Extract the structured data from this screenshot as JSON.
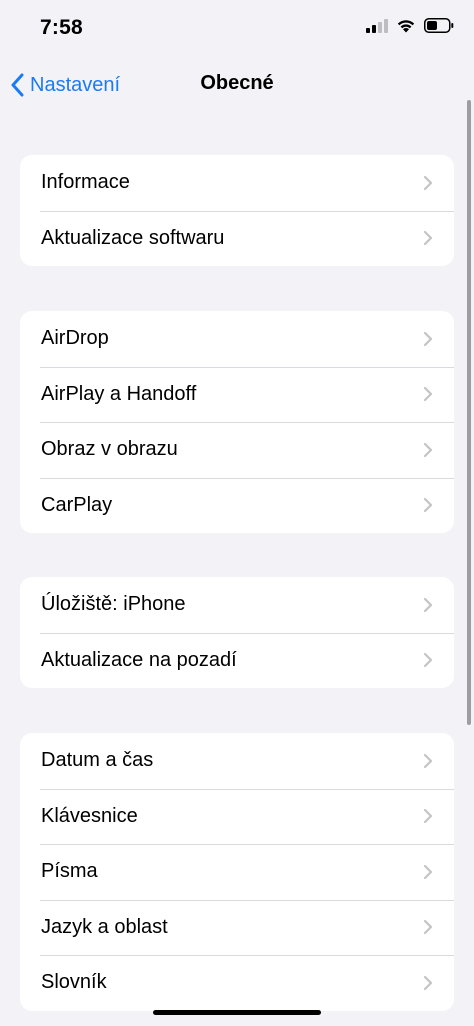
{
  "status_bar": {
    "time": "7:58"
  },
  "nav": {
    "back_label": "Nastavení",
    "title": "Obecné"
  },
  "groups": [
    {
      "items": [
        {
          "label": "Informace"
        },
        {
          "label": "Aktualizace softwaru"
        }
      ]
    },
    {
      "items": [
        {
          "label": "AirDrop"
        },
        {
          "label": "AirPlay a Handoff"
        },
        {
          "label": "Obraz v obrazu"
        },
        {
          "label": "CarPlay"
        }
      ]
    },
    {
      "items": [
        {
          "label": "Úložiště: iPhone"
        },
        {
          "label": "Aktualizace na pozadí"
        }
      ]
    },
    {
      "items": [
        {
          "label": "Datum a čas"
        },
        {
          "label": "Klávesnice"
        },
        {
          "label": "Písma"
        },
        {
          "label": "Jazyk a oblast"
        },
        {
          "label": "Slovník"
        }
      ]
    }
  ],
  "colors": {
    "accent": "#1a7cf5",
    "background": "#f2f2f7",
    "chevron": "#c4c4c7"
  },
  "icons": {
    "signal": "cellular-signal-icon",
    "wifi": "wifi-icon",
    "battery": "battery-icon",
    "back": "chevron-left-icon",
    "row": "chevron-right-icon"
  }
}
